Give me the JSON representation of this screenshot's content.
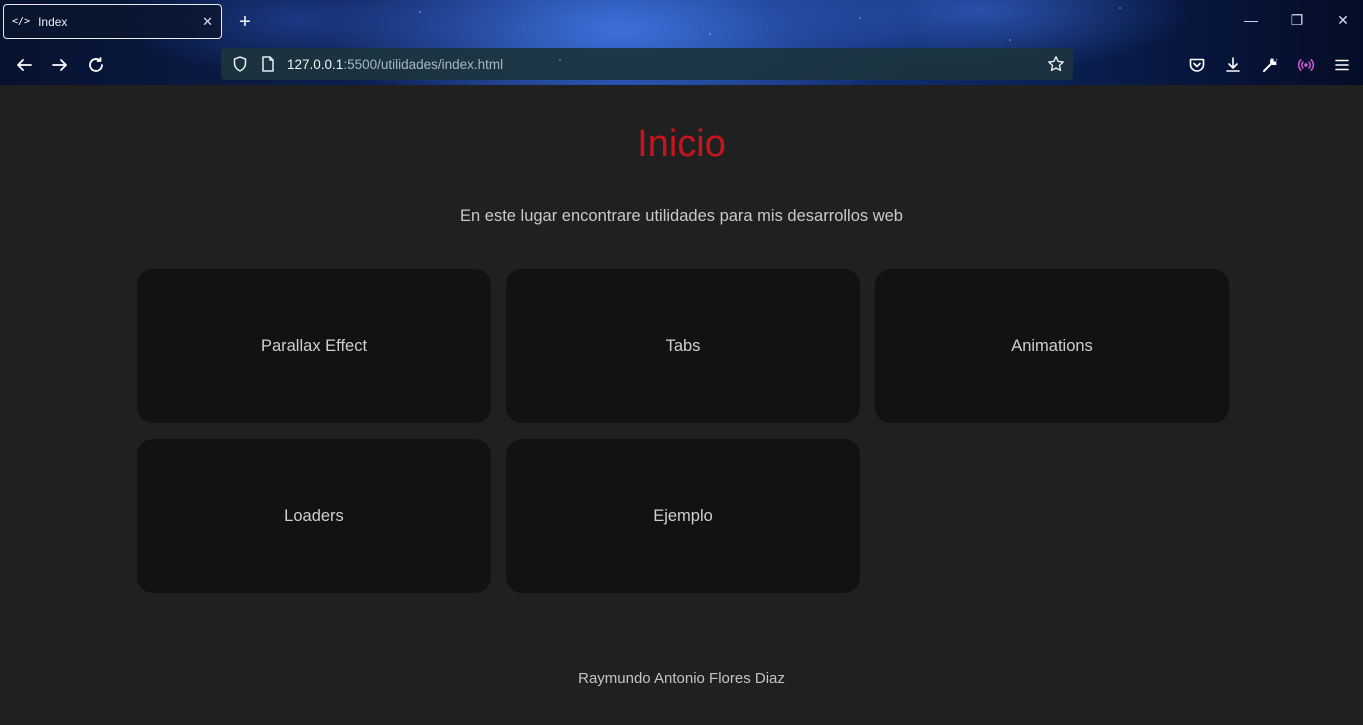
{
  "browser": {
    "tab": {
      "favicon": "</>",
      "title": "Index"
    },
    "url": {
      "host": "127.0.0.1",
      "path": ":5500/utilidades/index.html"
    },
    "icons": [
      "back-icon",
      "forward-icon",
      "reload-icon",
      "shield-icon",
      "page-icon",
      "star-icon",
      "pocket-icon",
      "download-icon",
      "wrench-icon",
      "broadcast-icon",
      "menu-icon",
      "minimize-icon",
      "restore-icon",
      "close-window-icon"
    ],
    "accent_broadcast": "#d45ad9"
  },
  "page": {
    "title": "Inicio",
    "title_color": "#c8141e",
    "subtitle": "En este lugar encontrare utilidades para mis desarrollos web",
    "cards": [
      {
        "label": "Parallax Effect"
      },
      {
        "label": "Tabs"
      },
      {
        "label": "Animations"
      },
      {
        "label": "Loaders"
      },
      {
        "label": "Ejemplo"
      }
    ],
    "footer": "Raymundo Antonio Flores Diaz"
  }
}
